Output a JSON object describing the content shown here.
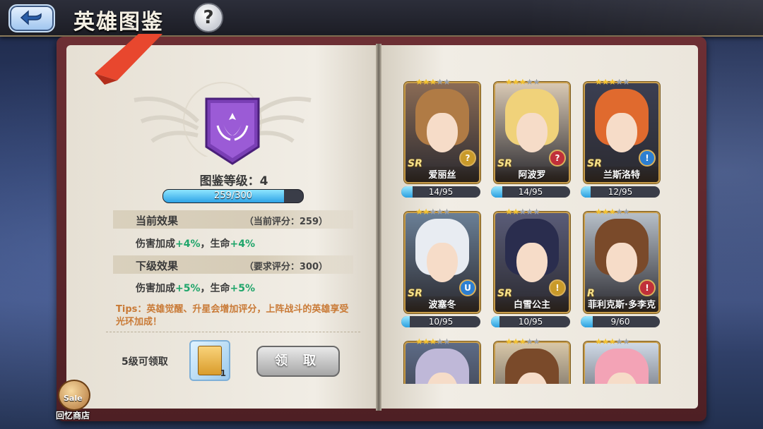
{
  "header": {
    "title": "英雄图鉴",
    "help_glyph": "?"
  },
  "codex": {
    "level_label": "图鉴等级：4",
    "xp_text": "259/300",
    "xp_fraction": 0.863,
    "current": {
      "label": "当前效果",
      "score": "（当前评分：259）",
      "effect_a": "伤害加成",
      "effect_a_val": "+4%",
      "sep": "，生命",
      "effect_b_val": "+4%"
    },
    "next": {
      "label": "下级效果",
      "score": "（要求评分：300）",
      "effect_a": "伤害加成",
      "effect_a_val": "+5%",
      "sep": "，生命",
      "effect_b_val": "+5%"
    },
    "tips": "Tips：英雄觉醒、升星会增加评分，上阵战斗的英雄享受光环加成！",
    "claim_label": "5级可领取",
    "reward_count": "1",
    "claim_button": "领 取"
  },
  "shop": {
    "badge": "Sale",
    "label": "回忆商店"
  },
  "heroes": [
    {
      "name": "爱丽丝",
      "rarity": "SR",
      "stars": 3,
      "role": "?",
      "progress_text": "14/95",
      "progress": 0.147,
      "hair": "#b07b45",
      "bg": "#8a6b55",
      "role_color": "#c99a2a"
    },
    {
      "name": "阿波罗",
      "rarity": "SR",
      "stars": 3,
      "role": "?",
      "progress_text": "14/95",
      "progress": 0.147,
      "hair": "#f0d27a",
      "bg": "#d9c9b4",
      "role_color": "#c0303a"
    },
    {
      "name": "兰斯洛特",
      "rarity": "SR",
      "stars": 3,
      "role": "!",
      "progress_text": "12/95",
      "progress": 0.126,
      "hair": "#e06a2e",
      "bg": "#3b3f52",
      "role_color": "#2d7fd1"
    },
    {
      "name": "波塞冬",
      "rarity": "SR",
      "stars": 2,
      "role": "U",
      "progress_text": "10/95",
      "progress": 0.105,
      "hair": "#e8ecf2",
      "bg": "#6a7f96",
      "role_color": "#2d7fd1"
    },
    {
      "name": "白雪公主",
      "rarity": "SR",
      "stars": 2,
      "role": "!",
      "progress_text": "10/95",
      "progress": 0.105,
      "hair": "#2a2d4e",
      "bg": "#5a5c78",
      "role_color": "#c99a2a"
    },
    {
      "name": "菲利克斯·多李克",
      "rarity": "R",
      "stars": 3,
      "role": "!",
      "progress_text": "9/60",
      "progress": 0.15,
      "hair": "#7a4a2a",
      "bg": "#b7bfc8",
      "role_color": "#c0303a"
    },
    {
      "name": "",
      "rarity": "",
      "stars": 3,
      "role": "",
      "progress_text": "",
      "progress": 0,
      "hair": "#bfb8d8",
      "bg": "#5d6b86",
      "role_color": "#2d7fd1"
    },
    {
      "name": "",
      "rarity": "",
      "stars": 3,
      "role": "",
      "progress_text": "",
      "progress": 0,
      "hair": "#7a4a2a",
      "bg": "#d8c7a8",
      "role_color": "#2d7fd1"
    },
    {
      "name": "",
      "rarity": "",
      "stars": 3,
      "role": "",
      "progress_text": "",
      "progress": 0,
      "hair": "#f3a3b6",
      "bg": "#cfd9e6",
      "role_color": "#2d7fd1"
    }
  ],
  "colors": {
    "accent_green": "#1fa56a",
    "tips_orange": "#c97a36",
    "bar_blue": "#2ea3e6"
  }
}
